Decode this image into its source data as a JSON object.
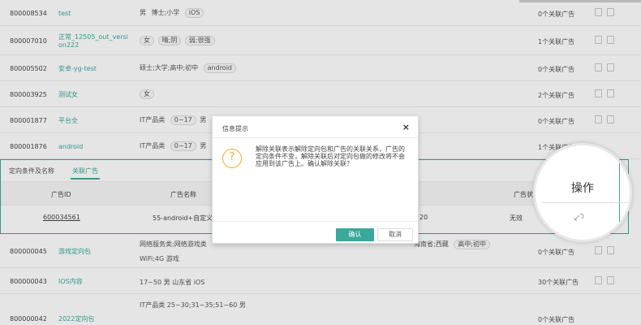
{
  "rows_top": [
    {
      "id": "800008534",
      "name": "test",
      "tags": [
        {
          "t": "男",
          "plain": true
        },
        {
          "t": "博士;小学",
          "plain": true
        },
        {
          "t": "iOS",
          "plain": false
        }
      ],
      "count": "0个关联广告"
    },
    {
      "id": "800007010",
      "name": "正常_12505_out_versi on222",
      "tags": [
        {
          "t": "女",
          "plain": false
        },
        {
          "t": "晴;阴",
          "plain": false
        },
        {
          "t": "弱;很强",
          "plain": false
        }
      ],
      "count": "1个关联广告"
    },
    {
      "id": "800005502",
      "name": "安卓-yg-test",
      "tags": [
        {
          "t": "硕士;大学;高中;初中",
          "plain": true
        },
        {
          "t": "android",
          "plain": false
        }
      ],
      "count": "0个关联广告"
    },
    {
      "id": "800003925",
      "name": "测试女",
      "tags": [
        {
          "t": "女",
          "plain": false
        }
      ],
      "count": "2个关联广告"
    },
    {
      "id": "800001877",
      "name": "平台全",
      "tags": [
        {
          "t": "IT产品类",
          "plain": true
        },
        {
          "t": "0~17",
          "plain": false
        },
        {
          "t": "男",
          "plain": true
        }
      ],
      "count": "0个关联广告"
    },
    {
      "id": "800001876",
      "name": "android",
      "tags": [
        {
          "t": "IT产品类",
          "plain": true
        },
        {
          "t": "0~17",
          "plain": false
        },
        {
          "t": "男",
          "plain": true
        }
      ],
      "count": "1个关联广告"
    }
  ],
  "expanded": {
    "tab1": "定向条件及名称",
    "tab2": "关联广告",
    "col_id": "广告ID",
    "col_name": "广告名称",
    "col_status": "广告状态",
    "row_id": "600034561",
    "row_name": "55-android+自定义",
    "row_extra": "20",
    "row_status": "无效"
  },
  "rows_bottom": [
    {
      "id": "800000045",
      "name": "游戏定向包",
      "line1": "网络服务类;网络游戏类",
      "line1b": "海南省;西藏",
      "line1c": "高中;初中",
      "line2": "WiFi;4G 游戏",
      "count": "0个关联广告"
    },
    {
      "id": "800000043",
      "name": "IOS内容",
      "line1": "17~50  男  山东省  iOS",
      "count": "30个关联广告"
    },
    {
      "id": "800000042",
      "name": "2022定向包",
      "line1": "IT产品类  25~30;31~35;51~60  男",
      "count": "0个关联广告"
    }
  ],
  "dialog": {
    "title": "信息提示",
    "close": "×",
    "message": "解除关联表示解除定向包和广告的关联关系，广告的定向条件不变，解除关联后对定向包做的修改将不会应用到该广告上。确认解除关联？",
    "ok": "确认",
    "cancel": "取消"
  },
  "magnifier": {
    "title": "操作"
  },
  "colors": {
    "accent": "#3aa89b",
    "warn": "#f0ad2e"
  }
}
